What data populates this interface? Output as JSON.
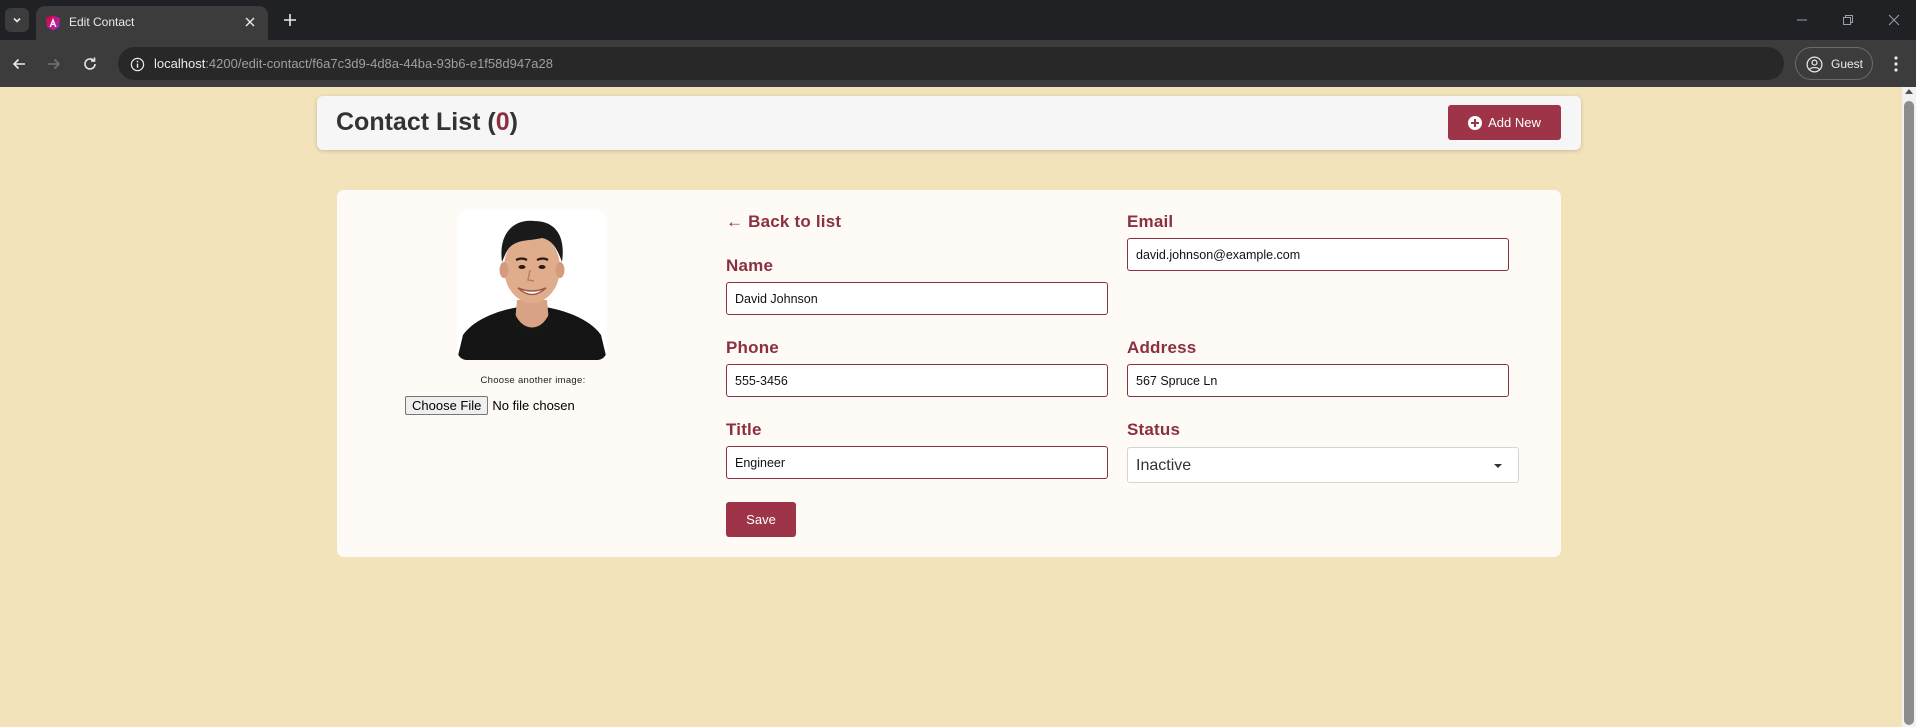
{
  "browser": {
    "tab_title": "Edit Contact",
    "url_host": "localhost",
    "url_path": ":4200/edit-contact/f6a7c3d9-4d8a-44ba-93b6-e1f58d947a28",
    "profile_label": "Guest"
  },
  "header": {
    "title_prefix": "Contact List (",
    "count": "0",
    "title_suffix": ")",
    "add_new_label": "Add New"
  },
  "image_panel": {
    "choose_label": "Choose another image:",
    "choose_button": "Choose File",
    "file_status": "No file chosen"
  },
  "form": {
    "back_link": "← Back to list",
    "name_label": "Name",
    "name_value": "David Johnson",
    "email_label": "Email",
    "email_value": "david.johnson@example.com",
    "phone_label": "Phone",
    "phone_value": "555-3456",
    "address_label": "Address",
    "address_value": "567 Spruce Ln",
    "title_label": "Title",
    "title_value": "Engineer",
    "status_label": "Status",
    "status_value": "Inactive",
    "save_label": "Save"
  },
  "colors": {
    "page_background": "#f2e3bb",
    "accent": "#9d3447",
    "label": "#8b3040"
  }
}
